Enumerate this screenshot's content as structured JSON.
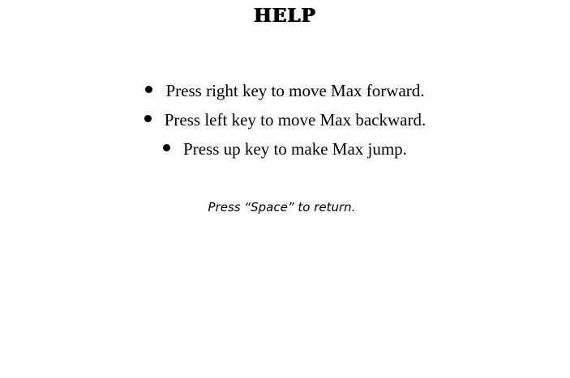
{
  "title": "HELP",
  "instructions": [
    {
      "text": "Press right key to move Max forward."
    },
    {
      "text": "Press left key to move Max  backward."
    },
    {
      "text": "Press up key to make Max jump."
    }
  ],
  "return_hint": "Press “Space” to return."
}
